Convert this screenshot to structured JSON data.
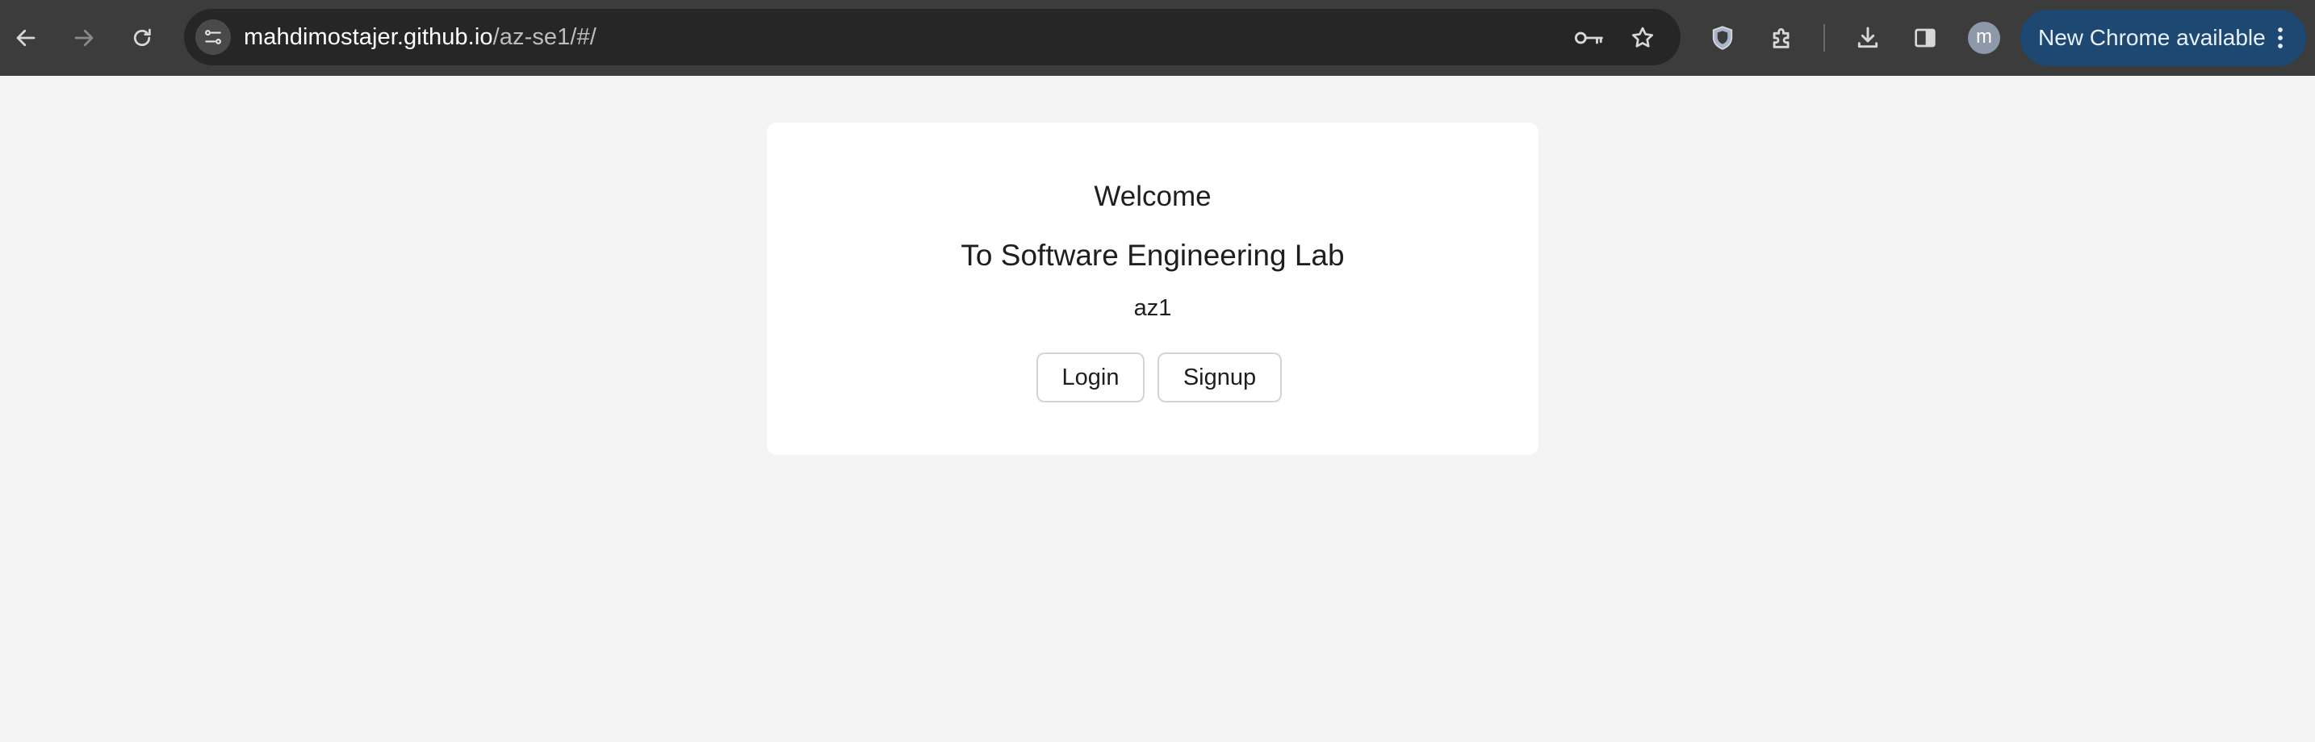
{
  "browser": {
    "address_host": "mahdimostajer.github.io",
    "address_path": "/az-se1/#/",
    "profile_initial": "m",
    "update_label": "New Chrome available",
    "icons": {
      "back": "arrow-left-icon",
      "forward": "arrow-right-icon",
      "reload": "reload-icon",
      "site_info": "tune-icon",
      "passwords": "key-icon",
      "bookmark": "star-icon",
      "shield": "shield-icon",
      "extensions": "puzzle-icon",
      "downloads": "download-icon",
      "side_panel": "side-panel-icon",
      "menu": "kebab-menu-icon"
    }
  },
  "page": {
    "welcome": "Welcome",
    "subtitle": "To Software Engineering Lab",
    "username": "az1",
    "login_label": "Login",
    "signup_label": "Signup"
  },
  "colors": {
    "page_background": "#f4f4f4",
    "toolbar": "#3c3c3c",
    "omnibox": "#262626",
    "update_pill": "#1c4872",
    "card": "#ffffff"
  }
}
